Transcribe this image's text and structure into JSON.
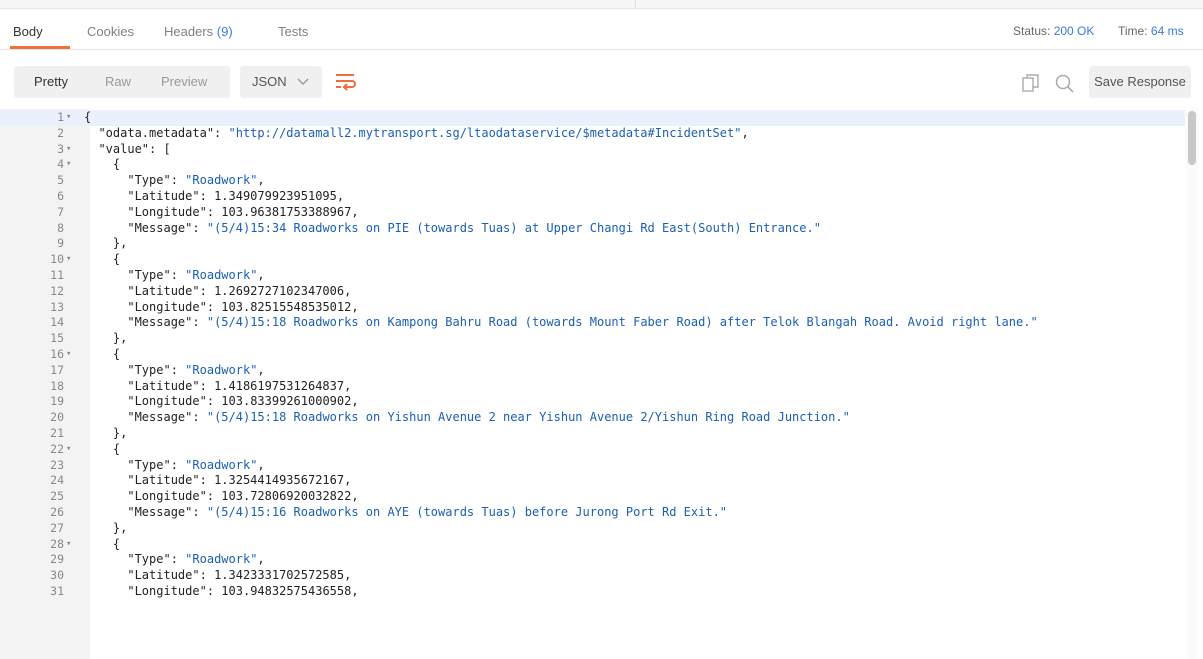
{
  "tabs": [
    {
      "label": "Body",
      "active": true
    },
    {
      "label": "Cookies",
      "active": false
    },
    {
      "label": "Headers",
      "count": "(9)",
      "active": false
    },
    {
      "label": "Tests",
      "active": false
    }
  ],
  "status": {
    "label": "Status:",
    "value": "200 OK",
    "time_label": "Time:",
    "time_value": "64 ms"
  },
  "toolbar": {
    "formats": [
      "Pretty",
      "Raw",
      "Preview"
    ],
    "active_format": "Pretty",
    "language": "JSON",
    "save_label": "Save Response"
  },
  "colors": {
    "accent": "#f26b3a",
    "link": "#3a7bd5",
    "string": "#1a5fb4"
  },
  "editor": {
    "lines": [
      {
        "n": "1",
        "fold": true,
        "text": "{"
      },
      {
        "n": "2",
        "fold": false,
        "indent": "  ",
        "key": "\"odata.metadata\"",
        "value": "\"http://datamall2.mytransport.sg/ltaodataservice/$metadata#IncidentSet\"",
        "suffix": ","
      },
      {
        "n": "3",
        "fold": true,
        "indent": "  ",
        "key": "\"value\"",
        "raw": "["
      },
      {
        "n": "4",
        "fold": true,
        "indent": "    ",
        "text": "{"
      },
      {
        "n": "5",
        "fold": false,
        "indent": "      ",
        "key": "\"Type\"",
        "value": "\"Roadwork\"",
        "suffix": ","
      },
      {
        "n": "6",
        "fold": false,
        "indent": "      ",
        "key": "\"Latitude\"",
        "num": "1.349079923951095",
        "suffix": ","
      },
      {
        "n": "7",
        "fold": false,
        "indent": "      ",
        "key": "\"Longitude\"",
        "num": "103.96381753388967",
        "suffix": ","
      },
      {
        "n": "8",
        "fold": false,
        "indent": "      ",
        "key": "\"Message\"",
        "value": "\"(5/4)15:34 Roadworks on PIE (towards Tuas) at Upper Changi Rd East(South) Entrance.\""
      },
      {
        "n": "9",
        "fold": false,
        "indent": "    ",
        "text": "},"
      },
      {
        "n": "10",
        "fold": true,
        "indent": "    ",
        "text": "{"
      },
      {
        "n": "11",
        "fold": false,
        "indent": "      ",
        "key": "\"Type\"",
        "value": "\"Roadwork\"",
        "suffix": ","
      },
      {
        "n": "12",
        "fold": false,
        "indent": "      ",
        "key": "\"Latitude\"",
        "num": "1.2692727102347006",
        "suffix": ","
      },
      {
        "n": "13",
        "fold": false,
        "indent": "      ",
        "key": "\"Longitude\"",
        "num": "103.82515548535012",
        "suffix": ","
      },
      {
        "n": "14",
        "fold": false,
        "indent": "      ",
        "key": "\"Message\"",
        "value": "\"(5/4)15:18 Roadworks on Kampong Bahru Road (towards Mount Faber Road) after Telok Blangah Road. Avoid right lane.\""
      },
      {
        "n": "15",
        "fold": false,
        "indent": "    ",
        "text": "},"
      },
      {
        "n": "16",
        "fold": true,
        "indent": "    ",
        "text": "{"
      },
      {
        "n": "17",
        "fold": false,
        "indent": "      ",
        "key": "\"Type\"",
        "value": "\"Roadwork\"",
        "suffix": ","
      },
      {
        "n": "18",
        "fold": false,
        "indent": "      ",
        "key": "\"Latitude\"",
        "num": "1.4186197531264837",
        "suffix": ","
      },
      {
        "n": "19",
        "fold": false,
        "indent": "      ",
        "key": "\"Longitude\"",
        "num": "103.83399261000902",
        "suffix": ","
      },
      {
        "n": "20",
        "fold": false,
        "indent": "      ",
        "key": "\"Message\"",
        "value": "\"(5/4)15:18 Roadworks on Yishun Avenue 2 near Yishun Avenue 2/Yishun Ring Road Junction.\""
      },
      {
        "n": "21",
        "fold": false,
        "indent": "    ",
        "text": "},"
      },
      {
        "n": "22",
        "fold": true,
        "indent": "    ",
        "text": "{"
      },
      {
        "n": "23",
        "fold": false,
        "indent": "      ",
        "key": "\"Type\"",
        "value": "\"Roadwork\"",
        "suffix": ","
      },
      {
        "n": "24",
        "fold": false,
        "indent": "      ",
        "key": "\"Latitude\"",
        "num": "1.3254414935672167",
        "suffix": ","
      },
      {
        "n": "25",
        "fold": false,
        "indent": "      ",
        "key": "\"Longitude\"",
        "num": "103.72806920032822",
        "suffix": ","
      },
      {
        "n": "26",
        "fold": false,
        "indent": "      ",
        "key": "\"Message\"",
        "value": "\"(5/4)15:16 Roadworks on AYE (towards Tuas) before Jurong Port Rd Exit.\""
      },
      {
        "n": "27",
        "fold": false,
        "indent": "    ",
        "text": "},"
      },
      {
        "n": "28",
        "fold": true,
        "indent": "    ",
        "text": "{"
      },
      {
        "n": "29",
        "fold": false,
        "indent": "      ",
        "key": "\"Type\"",
        "value": "\"Roadwork\"",
        "suffix": ","
      },
      {
        "n": "30",
        "fold": false,
        "indent": "      ",
        "key": "\"Latitude\"",
        "num": "1.3423331702572585",
        "suffix": ","
      },
      {
        "n": "31",
        "fold": false,
        "indent": "      ",
        "key": "\"Longitude\"",
        "num": "103.94832575436558",
        "suffix": ","
      }
    ]
  }
}
